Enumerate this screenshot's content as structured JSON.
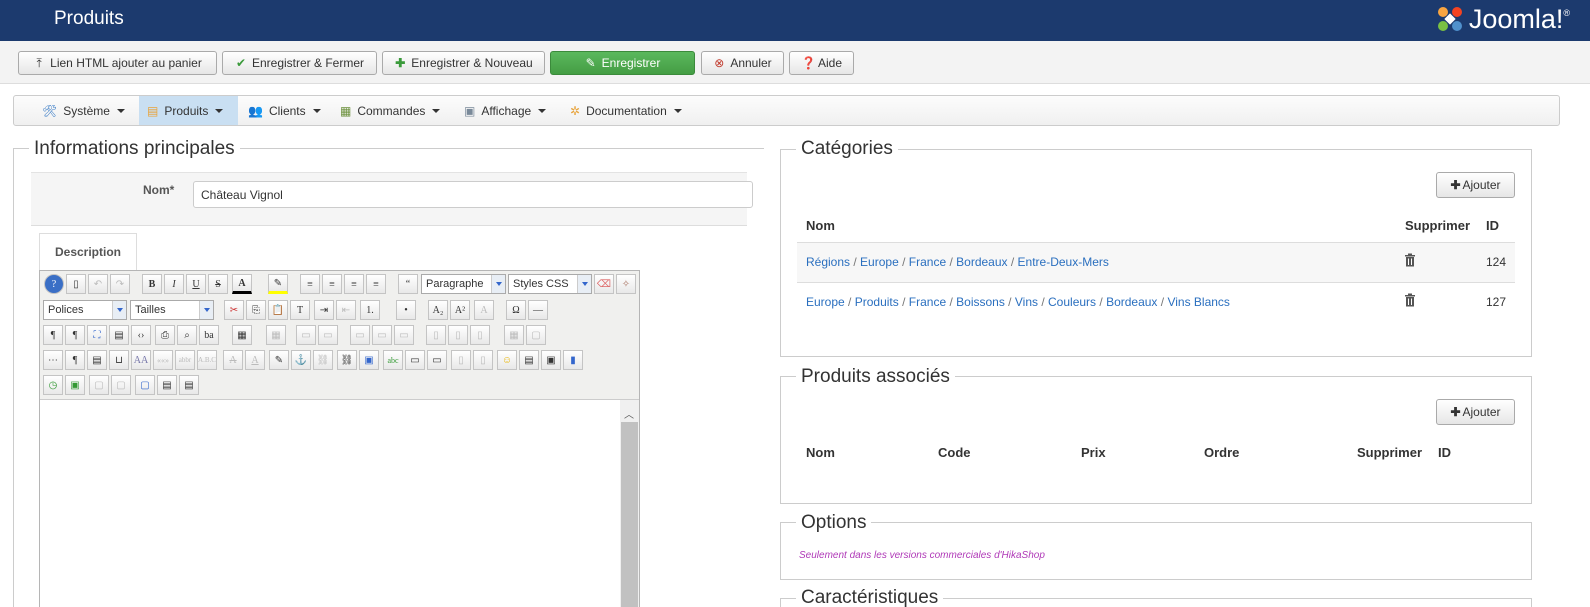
{
  "header": {
    "title": "Produits",
    "logo_text": "Joomla!"
  },
  "toolbar": {
    "buttons": [
      {
        "label": "Lien HTML ajouter au panier",
        "icon": "upload-icon"
      },
      {
        "label": "Enregistrer & Fermer",
        "icon": "check-icon"
      },
      {
        "label": "Enregistrer & Nouveau",
        "icon": "plus-icon"
      },
      {
        "label": "Enregistrer",
        "icon": "edit-icon"
      },
      {
        "label": "Annuler",
        "icon": "cancel-icon"
      },
      {
        "label": "Aide",
        "icon": "help-icon"
      }
    ]
  },
  "menu": {
    "items": [
      {
        "label": "Système"
      },
      {
        "label": "Produits"
      },
      {
        "label": "Clients"
      },
      {
        "label": "Commandes"
      },
      {
        "label": "Affichage"
      },
      {
        "label": "Documentation"
      }
    ]
  },
  "main_info": {
    "legend": "Informations principales",
    "name_label": "Nom*",
    "name_value": "Château Vignol",
    "description_tab": "Description"
  },
  "editor": {
    "format_select": "Paragraphe",
    "styles_select": "Styles CSS",
    "font_select": "Polices",
    "size_select": "Tailles"
  },
  "categories": {
    "legend": "Catégories",
    "add_label": "Ajouter",
    "col_name": "Nom",
    "col_delete": "Supprimer",
    "col_id": "ID",
    "rows": [
      {
        "path": [
          "Régions",
          "Europe",
          "France",
          "Bordeaux",
          "Entre-Deux-Mers"
        ],
        "id": "124"
      },
      {
        "path": [
          "Europe",
          "Produits",
          "France",
          "Boissons",
          "Vins",
          "Couleurs",
          "Bordeaux",
          "Vins Blancs"
        ],
        "id": "127"
      }
    ]
  },
  "related": {
    "legend": "Produits associés",
    "add_label": "Ajouter",
    "col_name": "Nom",
    "col_code": "Code",
    "col_price": "Prix",
    "col_order": "Ordre",
    "col_delete": "Supprimer",
    "col_id": "ID"
  },
  "options": {
    "legend": "Options",
    "note": "Seulement dans les versions commerciales d'HikaShop"
  },
  "features": {
    "legend": "Caractéristiques"
  },
  "colors": {
    "header_bg": "#1c3a6e",
    "primary_btn": "#4cae4c",
    "link": "#2a6fbf",
    "note": "#b03ab8"
  }
}
